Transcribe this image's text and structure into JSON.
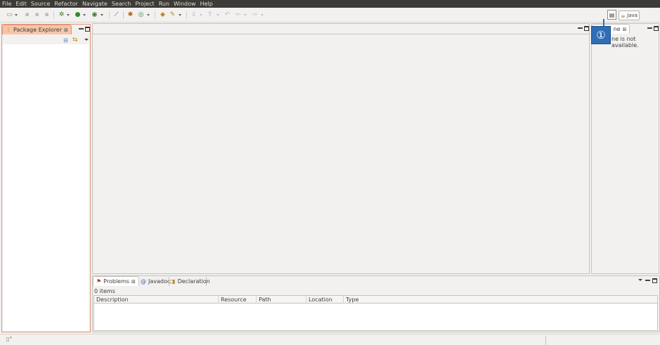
{
  "menu": [
    "File",
    "Edit",
    "Source",
    "Refactor",
    "Navigate",
    "Search",
    "Project",
    "Run",
    "Window",
    "Help"
  ],
  "perspective": {
    "java_label": "Java"
  },
  "package_explorer": {
    "tab_label": "Package Explorer"
  },
  "outline": {
    "tab_label_partial": "ne",
    "message_partial": "ne is not available."
  },
  "problems": {
    "tabs": [
      "Problems",
      "Javadoc",
      "Declaration"
    ],
    "count": "0 items",
    "columns": [
      "Description",
      "Resource",
      "Path",
      "Location",
      "Type"
    ]
  },
  "badge": {
    "number": "①"
  },
  "colors": {
    "badge": "#2f6db5",
    "active_tab": "#f6c5a8"
  }
}
